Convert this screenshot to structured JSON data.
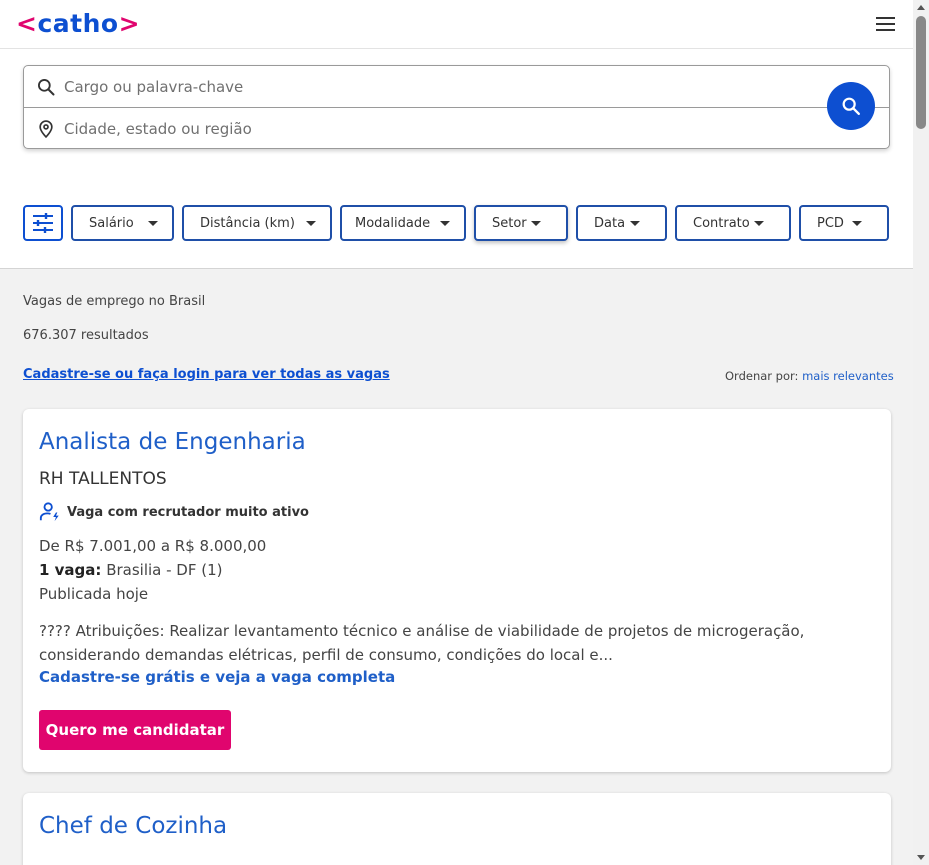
{
  "header": {
    "logo_left": "<",
    "logo_text": "catho",
    "logo_right": ">",
    "menu_icon": "hamburger-menu-icon"
  },
  "search": {
    "keyword_placeholder": "Cargo ou palavra-chave",
    "location_placeholder": "Cidade, estado ou região",
    "keyword_icon": "search-icon",
    "location_icon": "location-pin-icon",
    "button_icon": "search-icon"
  },
  "filters": {
    "settings_icon": "sliders-icon",
    "chips": [
      "Salário",
      "Distância (km)",
      "Modalidade",
      "Setor",
      "Data",
      "Contrato",
      "PCD"
    ]
  },
  "results": {
    "heading": "Vagas de emprego no Brasil",
    "count": "676.307 resultados",
    "login_link": "Cadastre-se ou faça login para ver todas as vagas",
    "order_label": "Ordenar por:",
    "order_value": "mais relevantes"
  },
  "jobs": [
    {
      "title": "Analista de Engenharia",
      "company": "RH TALLENTOS",
      "recruiter_badge": "Vaga com recrutador muito ativo",
      "salary": "De R$ 7.001,00 a R$ 8.000,00",
      "vacancies_label": "1 vaga:",
      "location": "Brasilia - DF (1)",
      "published": "Publicada hoje",
      "description": "???? Atribuições: Realizar levantamento técnico e análise de viabilidade de projetos de microgeração, considerando demandas elétricas, perfil de consumo, condições do local e...",
      "cta_link": "Cadastre-se grátis e veja a vaga completa",
      "apply_label": "Quero me candidatar"
    },
    {
      "title": "Chef de Cozinha"
    }
  ],
  "colors": {
    "brand_blue": "#0d4fd1",
    "brand_pink": "#e0056e",
    "link_blue": "#1f5fc8"
  }
}
